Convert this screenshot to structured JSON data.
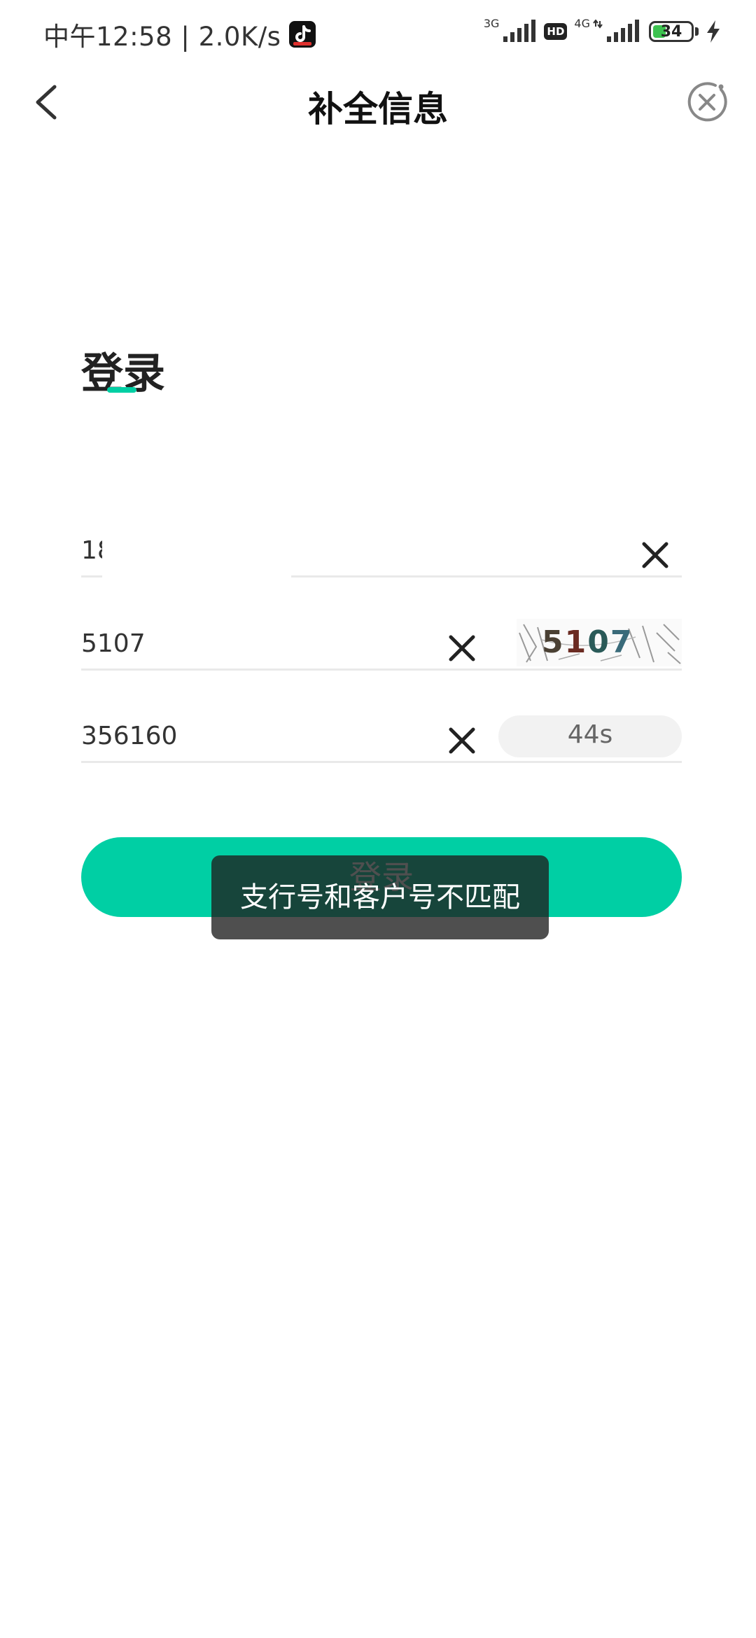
{
  "status_bar": {
    "time_speed": "中午12:58 | 2.0K/s",
    "net1": "3G",
    "hd": "HD",
    "net2": "4G",
    "battery": "34",
    "battery_level": 0.34
  },
  "header": {
    "title": "补全信息"
  },
  "login": {
    "heading": "登录",
    "accent_color": "#00cfa4"
  },
  "form": {
    "phone_value": "18",
    "captcha_value": "5107",
    "captcha_image_text": [
      "5",
      "1",
      "0",
      "7"
    ],
    "sms_value": "356160",
    "countdown": "44s"
  },
  "login_button": {
    "label": "登录"
  },
  "toast": {
    "message": "支行号和客户号不匹配"
  },
  "icons": {
    "back": "chevron-left-icon",
    "close": "close-circle-icon",
    "clear": "clear-x-icon",
    "app": "tiktok-icon",
    "charging": "lightning-icon"
  }
}
